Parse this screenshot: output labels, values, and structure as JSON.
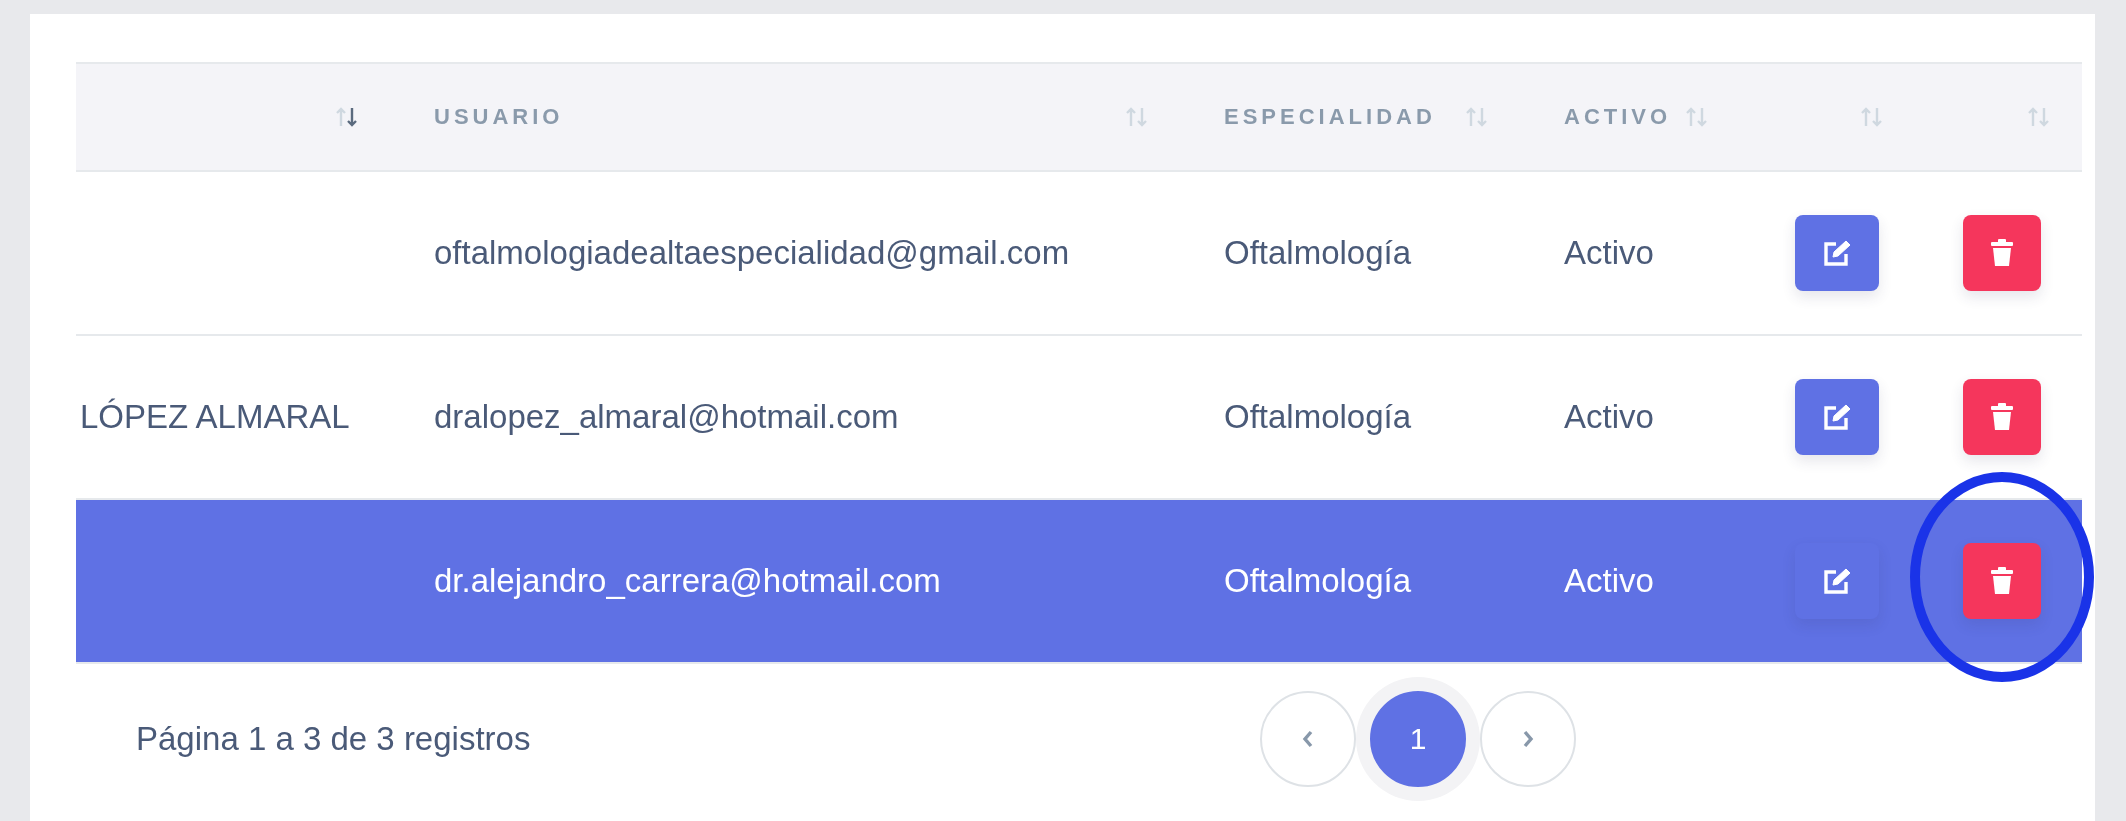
{
  "table": {
    "columns": [
      {
        "sorted": true
      },
      {
        "label": "USUARIO",
        "sorted": false
      },
      {
        "label": "ESPECIALIDAD",
        "sorted": false
      },
      {
        "label": "ACTIVO",
        "sorted": false
      },
      {
        "sorted": false
      },
      {
        "sorted": false
      }
    ],
    "rows": [
      {
        "user": "oftalmologiadealtaespecialidad@gmail.com",
        "specialty": "Oftalmología",
        "status": "Activo",
        "selected": false,
        "circled": false
      },
      {
        "name": "LÓPEZ ALMARAL",
        "user": "dralopez_almaral@hotmail.com",
        "specialty": "Oftalmología",
        "status": "Activo",
        "selected": false,
        "circled": false
      },
      {
        "user": "dr.alejandro_carrera@hotmail.com",
        "specialty": "Oftalmología",
        "status": "Activo",
        "selected": true,
        "circled": true
      }
    ]
  },
  "pagination": {
    "summary": "Página 1 a 3 de 3 registros",
    "pages": [
      {
        "label": "1",
        "selected": true
      }
    ]
  }
}
